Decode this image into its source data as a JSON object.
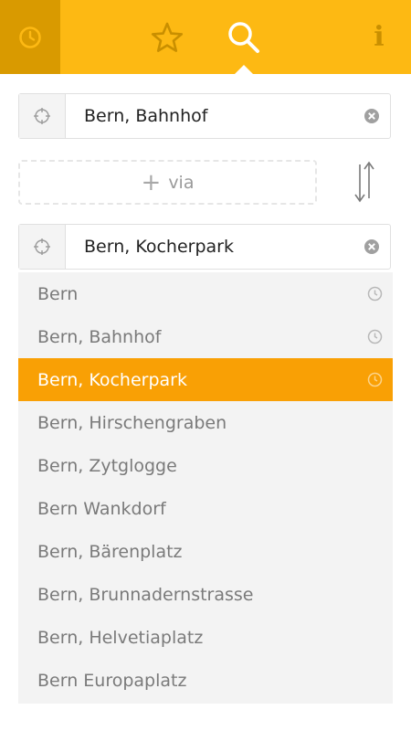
{
  "nav": {
    "tabs": [
      {
        "id": "history",
        "icon": "clock-icon"
      },
      {
        "id": "favorites",
        "icon": "star-icon"
      },
      {
        "id": "search",
        "icon": "search-icon"
      },
      {
        "id": "info",
        "icon": "info-icon",
        "glyph": "i"
      }
    ],
    "active_tab": "search"
  },
  "from": {
    "value": "Bern, Bahnhof",
    "locate_icon": "crosshair-icon",
    "clear_icon": "clear-icon"
  },
  "via": {
    "plus": "+",
    "label": "via"
  },
  "swap_icon": "swap-arrows-icon",
  "to": {
    "value": "Bern, Kocherpark",
    "locate_icon": "crosshair-icon",
    "clear_icon": "clear-icon"
  },
  "suggestions": [
    {
      "label": "Bern",
      "history": true
    },
    {
      "label": "Bern, Bahnhof",
      "history": true
    },
    {
      "label": "Bern, Kocherpark",
      "history": true,
      "active": true
    },
    {
      "label": "Bern, Hirschengraben",
      "history": false
    },
    {
      "label": "Bern, Zytglogge",
      "history": false
    },
    {
      "label": "Bern Wankdorf",
      "history": false
    },
    {
      "label": "Bern, Bärenplatz",
      "history": false
    },
    {
      "label": "Bern, Brunnadernstrasse",
      "history": false
    },
    {
      "label": "Bern, Helvetiaplatz",
      "history": false
    },
    {
      "label": "Bern Europaplatz",
      "history": false
    }
  ],
  "colors": {
    "brand": "#fdb913",
    "brand_dark": "#d99a00",
    "active_row": "#f9a005",
    "list_bg": "#f3f3f3"
  }
}
